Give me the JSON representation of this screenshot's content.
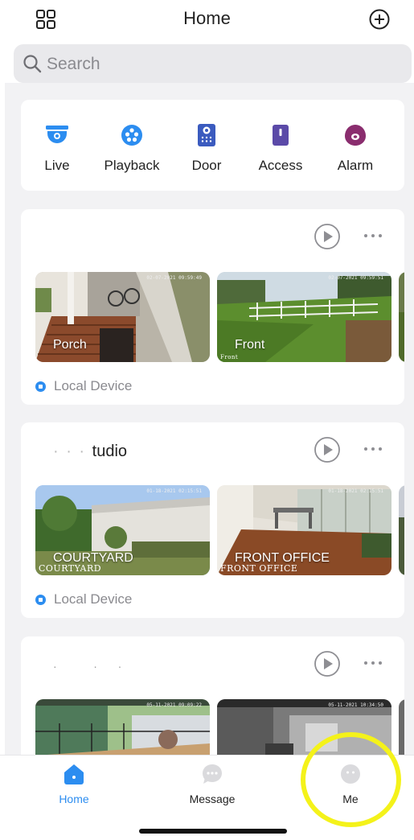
{
  "header": {
    "title": "Home",
    "grid_icon": "apps-grid-icon",
    "add_icon": "add-circle-icon"
  },
  "search": {
    "placeholder": "Search"
  },
  "quick_access": [
    {
      "label": "Live",
      "icon": "dome-camera-icon",
      "color": "#2c8df0"
    },
    {
      "label": "Playback",
      "icon": "film-reel-icon",
      "color": "#2c8df0"
    },
    {
      "label": "Door",
      "icon": "intercom-icon",
      "color": "#3b5bbf"
    },
    {
      "label": "Access",
      "icon": "door-access-icon",
      "color": "#5b4aa8"
    },
    {
      "label": "Alarm",
      "icon": "alarm-sensor-icon",
      "color": "#8a2d6e"
    }
  ],
  "devices": [
    {
      "title": "",
      "source": "Local Device",
      "cameras": [
        {
          "label": "Porch",
          "overlay": ""
        },
        {
          "label": "Front",
          "overlay": "Front"
        }
      ]
    },
    {
      "title": "tudio",
      "source": "Local Device",
      "cameras": [
        {
          "label": "COURTYARD",
          "overlay": "COURTYARD"
        },
        {
          "label": "FRONT OFFICE",
          "overlay": "FRONT OFFICE"
        }
      ]
    },
    {
      "title": "",
      "source": "",
      "cameras": [
        {
          "label": "",
          "overlay": ""
        },
        {
          "label": "",
          "overlay": ""
        }
      ]
    }
  ],
  "tabs": [
    {
      "label": "Home",
      "icon": "home-icon",
      "active": true
    },
    {
      "label": "Message",
      "icon": "message-bubble-icon",
      "active": false
    },
    {
      "label": "Me",
      "icon": "profile-icon",
      "active": false
    }
  ],
  "colors": {
    "accent": "#2c8df0",
    "highlight": "#f4f21a",
    "background": "#f2f2f4"
  }
}
